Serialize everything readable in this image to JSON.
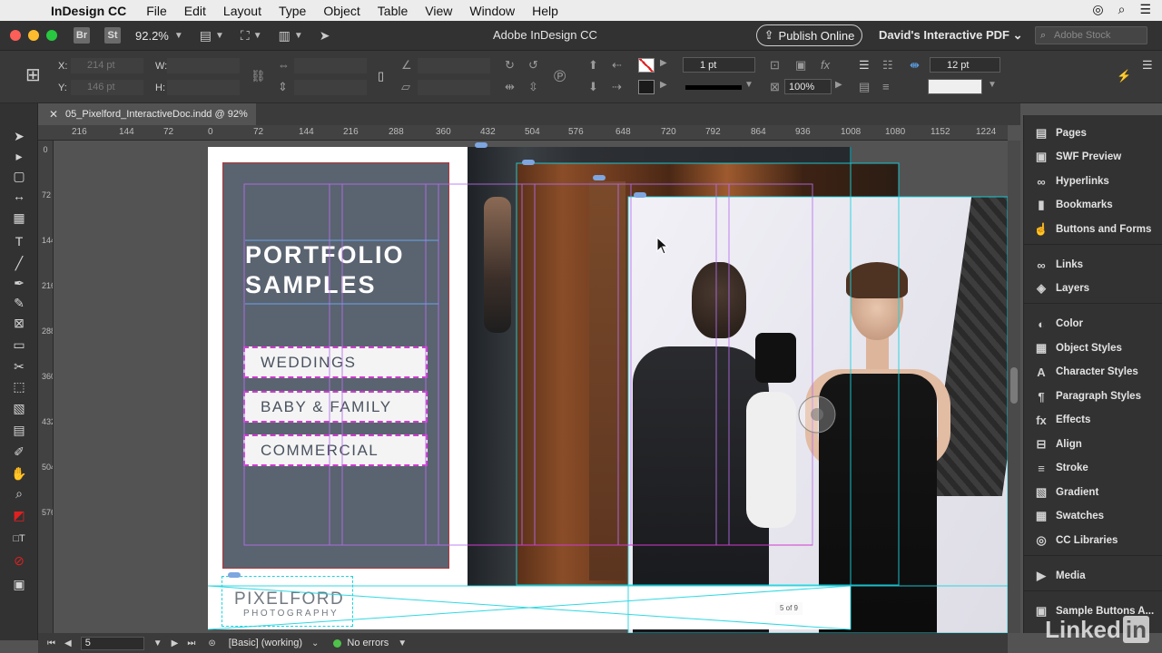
{
  "menubar": {
    "app_name": "InDesign CC",
    "items": [
      "File",
      "Edit",
      "Layout",
      "Type",
      "Object",
      "Table",
      "View",
      "Window",
      "Help"
    ]
  },
  "appbar": {
    "badges": [
      "Br",
      "St"
    ],
    "zoom": "92.2%",
    "document_title": "Adobe InDesign CC",
    "publish_label": "Publish Online",
    "workspace": "David's Interactive PDF",
    "stock_placeholder": "Adobe Stock"
  },
  "control": {
    "x_label": "X:",
    "y_label": "Y:",
    "w_label": "W:",
    "h_label": "H:",
    "x_value": "214 pt",
    "y_value": "146 pt",
    "stroke_weight": "1 pt",
    "opacity": "100%",
    "spacing": "12 pt"
  },
  "tab": {
    "label": "05_Pixelford_InteractiveDoc.indd @ 92%"
  },
  "ruler": {
    "h_labels": [
      "216",
      "144",
      "72",
      "0",
      "72",
      "144",
      "216",
      "288",
      "360",
      "432",
      "504",
      "576",
      "648",
      "720",
      "792",
      "864",
      "936",
      "1008",
      "1080",
      "1152",
      "1224"
    ],
    "v_labels": [
      "0",
      "72",
      "144",
      "216",
      "288",
      "360",
      "432",
      "504",
      "576"
    ]
  },
  "layout": {
    "heading_line1": "PORTFOLIO",
    "heading_line2": "SAMPLES",
    "buttons": [
      "WEDDINGS",
      "BABY & FAMILY",
      "COMMERCIAL"
    ],
    "logo_main": "PIXELFORD",
    "logo_sub": "PHOTOGRAPHY",
    "pager": "5 of 9"
  },
  "panels": {
    "items": [
      {
        "label": "Pages",
        "icon": "pages-icon"
      },
      {
        "label": "SWF Preview",
        "icon": "swf-preview-icon"
      },
      {
        "label": "Hyperlinks",
        "icon": "hyperlinks-icon"
      },
      {
        "label": "Bookmarks",
        "icon": "bookmarks-icon"
      },
      {
        "label": "Buttons and Forms",
        "icon": "buttons-forms-icon"
      },
      {
        "label": "Links",
        "icon": "links-icon"
      },
      {
        "label": "Layers",
        "icon": "layers-icon"
      },
      {
        "label": "Color",
        "icon": "color-icon"
      },
      {
        "label": "Object Styles",
        "icon": "object-styles-icon"
      },
      {
        "label": "Character Styles",
        "icon": "character-styles-icon"
      },
      {
        "label": "Paragraph Styles",
        "icon": "paragraph-styles-icon"
      },
      {
        "label": "Effects",
        "icon": "effects-icon"
      },
      {
        "label": "Align",
        "icon": "align-icon"
      },
      {
        "label": "Stroke",
        "icon": "stroke-icon"
      },
      {
        "label": "Gradient",
        "icon": "gradient-icon"
      },
      {
        "label": "Swatches",
        "icon": "swatches-icon"
      },
      {
        "label": "CC Libraries",
        "icon": "cc-libraries-icon"
      },
      {
        "label": "Media",
        "icon": "media-icon"
      },
      {
        "label": "Sample Buttons A...",
        "icon": "sample-buttons-icon"
      }
    ]
  },
  "status": {
    "page": "5",
    "style": "[Basic] (working)",
    "preflight": "No errors"
  },
  "watermark": {
    "text": "Linked",
    "suffix": "in"
  },
  "colors": {
    "accent_magenta": "#d13ad0",
    "guide_cyan": "#19d4e0",
    "panel_slate": "#5a6370",
    "preflight_green": "#4fc24a"
  }
}
